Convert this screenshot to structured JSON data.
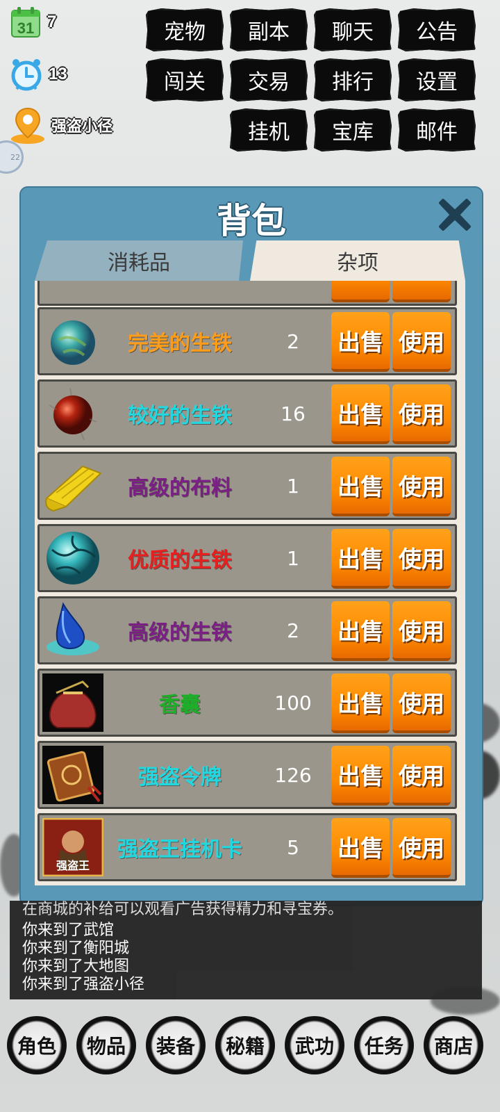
{
  "hud": {
    "calendar_day_icon_text": "31",
    "calendar_value": "7",
    "alarm_value": "13",
    "location": "强盗小径",
    "side_badge": "22"
  },
  "top_menu": [
    {
      "label": "宠物"
    },
    {
      "label": "副本"
    },
    {
      "label": "聊天"
    },
    {
      "label": "公告"
    },
    {
      "label": "闯关"
    },
    {
      "label": "交易"
    },
    {
      "label": "排行"
    },
    {
      "label": "设置"
    },
    {
      "label": "挂机"
    },
    {
      "label": "宝库"
    },
    {
      "label": "邮件"
    }
  ],
  "bag": {
    "title": "背包",
    "tabs": [
      {
        "label": "消耗品",
        "active": false
      },
      {
        "label": "杂项",
        "active": true
      }
    ],
    "sell_label": "出售",
    "use_label": "使用",
    "items": [
      {
        "name": "完美的生铁",
        "qty": "2",
        "color": "#ff9c1a",
        "icon": "teal-orb-icon"
      },
      {
        "name": "较好的生铁",
        "qty": "16",
        "color": "#22d8e0",
        "icon": "red-orb-icon"
      },
      {
        "name": "高级的布料",
        "qty": "1",
        "color": "#7b1f86",
        "icon": "cloth-roll-icon"
      },
      {
        "name": "优质的生铁",
        "qty": "1",
        "color": "#e81f1f",
        "icon": "cyan-stone-icon"
      },
      {
        "name": "高级的生铁",
        "qty": "2",
        "color": "#7b1f86",
        "icon": "blue-crystal-icon"
      },
      {
        "name": "香囊",
        "qty": "100",
        "color": "#1fae2a",
        "icon": "sachet-icon"
      },
      {
        "name": "强盗令牌",
        "qty": "126",
        "color": "#22d8e0",
        "icon": "bandit-token-icon"
      },
      {
        "name": "强盗王挂机卡",
        "qty": "5",
        "color": "#22d8e0",
        "icon": "bandit-king-card-icon",
        "icon_text": "强盗王"
      }
    ]
  },
  "log": {
    "lines": [
      "在商城的补给可以观看广告获得精力和寻宝券。",
      "你来到了武馆",
      "你来到了衡阳城",
      "你来到了大地图",
      "你来到了强盗小径"
    ]
  },
  "bottom_nav": [
    {
      "label": "角色"
    },
    {
      "label": "物品"
    },
    {
      "label": "装备"
    },
    {
      "label": "秘籍"
    },
    {
      "label": "武功"
    },
    {
      "label": "任务"
    },
    {
      "label": "商店"
    }
  ]
}
